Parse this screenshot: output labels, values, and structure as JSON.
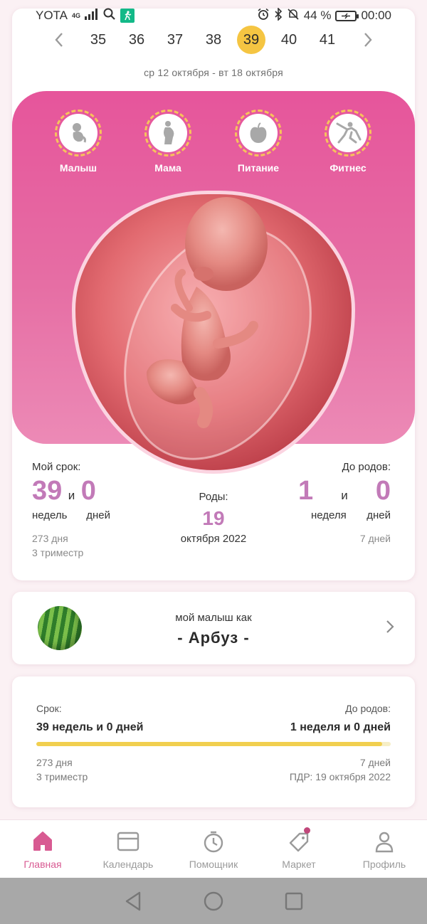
{
  "status_bar": {
    "carrier": "YOTA",
    "network": "4G",
    "battery_pct": "44 %",
    "time": "00:00"
  },
  "weeks": {
    "items": [
      "35",
      "36",
      "37",
      "38",
      "39",
      "40",
      "41"
    ],
    "selected": "39",
    "date_range": "ср 12 октября - вт 18 октября"
  },
  "categories": [
    "Малыш",
    "Мама",
    "Питание",
    "Фитнес"
  ],
  "pregnancy": {
    "my_term_label": "Мой срок:",
    "weeks_value": "39",
    "and_word": "и",
    "days_value": "0",
    "weeks_unit": "недель",
    "days_unit": "дней",
    "days_total": "273 дня",
    "trimester": "3 триместр",
    "birth_label": "Роды:",
    "birth_day": "19",
    "birth_month_year": "октября 2022",
    "until_label": "До родов:",
    "until_weeks": "1",
    "until_and": "и",
    "until_days": "0",
    "until_weeks_unit": "неделя",
    "until_days_unit": "дней",
    "until_total": "7 дней"
  },
  "fruit": {
    "line1": "мой малыш как",
    "name": "- Арбуз -"
  },
  "progress": {
    "term_label": "Срок:",
    "term_value": "39 недель и 0 дней",
    "until_label": "До родов:",
    "until_value": "1 неделя и 0 дней",
    "days_total": "273 дня",
    "trimester": "3 триместр",
    "remaining": "7 дней",
    "due_date": "ПДР: 19 октября 2022",
    "fraction": 0.975
  },
  "nav": {
    "items": [
      {
        "label": "Главная"
      },
      {
        "label": "Календарь"
      },
      {
        "label": "Помощник"
      },
      {
        "label": "Маркет"
      },
      {
        "label": "Профиль"
      }
    ],
    "active": "Главная"
  },
  "colors": {
    "accent_pink": "#e6559b",
    "number_purple": "#c27ab8",
    "selected_week": "#f5c542",
    "progress_fill": "#f1cf4f",
    "nav_active": "#d85a92"
  }
}
